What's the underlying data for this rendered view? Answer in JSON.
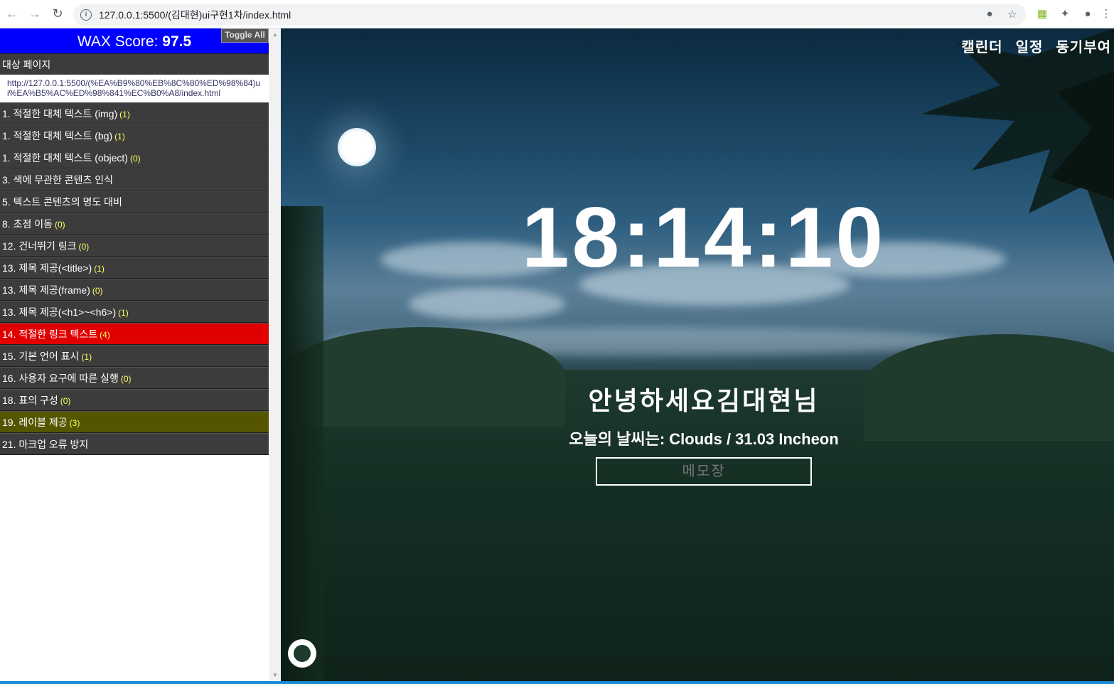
{
  "browser": {
    "url": "127.0.0.1:5500/(김대현)ui구현1차/index.html",
    "back_icon": "arrow-left-icon",
    "forward_icon": "arrow-right-icon",
    "reload_icon": "reload-icon"
  },
  "wax": {
    "score_label": "WAX Score:",
    "score_value": "97.5",
    "toggle_all": "Toggle All",
    "target_label": "대상 페이지",
    "target_url": "http://127.0.0.1:5500/(%EA%B9%80%EB%8C%80%ED%98%84)ui%EA%B5%AC%ED%98%841%EC%B0%A8/index.html",
    "items": [
      {
        "label": "1. 적절한 대체 텍스트 (img)",
        "count": "(1)"
      },
      {
        "label": "1. 적절한 대체 텍스트 (bg)",
        "count": "(1)"
      },
      {
        "label": "1. 적절한 대체 텍스트 (object)",
        "count": "(0)"
      },
      {
        "label": "3. 색에 무관한 콘텐츠 인식",
        "count": ""
      },
      {
        "label": "5. 텍스트 콘텐츠의 명도 대비",
        "count": ""
      },
      {
        "label": "8. 초점 이동",
        "count": "(0)"
      },
      {
        "label": "12. 건너뛰기 링크",
        "count": "(0)"
      },
      {
        "label": "13. 제목 제공(<title>)",
        "count": "(1)"
      },
      {
        "label": "13. 제목 제공(frame)",
        "count": "(0)"
      },
      {
        "label": "13. 제목 제공(<h1>~<h6>)",
        "count": "(1)"
      },
      {
        "label": "14. 적절한 링크 텍스트",
        "count": "(4)"
      },
      {
        "label": "15. 기본 언어 표시",
        "count": "(1)"
      },
      {
        "label": "16. 사용자 요구에 따른 실행",
        "count": "(0)"
      },
      {
        "label": "18. 표의 구성",
        "count": "(0)"
      },
      {
        "label": "19. 레이블 제공",
        "count": "(3)"
      },
      {
        "label": "21. 마크업 오류 방지",
        "count": ""
      }
    ],
    "colors": {
      "header": "#0000ff",
      "error": "#e10000",
      "warning": "#555500",
      "item": "#3c3c3c"
    }
  },
  "page": {
    "nav": [
      "캘린더",
      "일정",
      "동기부여"
    ],
    "clock": "18:14:10",
    "greeting": "안녕하세요김대현님",
    "weather": "오늘의 날씨는: Clouds / 31.03 Incheon",
    "memo_placeholder": "메모장",
    "github_icon": "github-icon"
  }
}
